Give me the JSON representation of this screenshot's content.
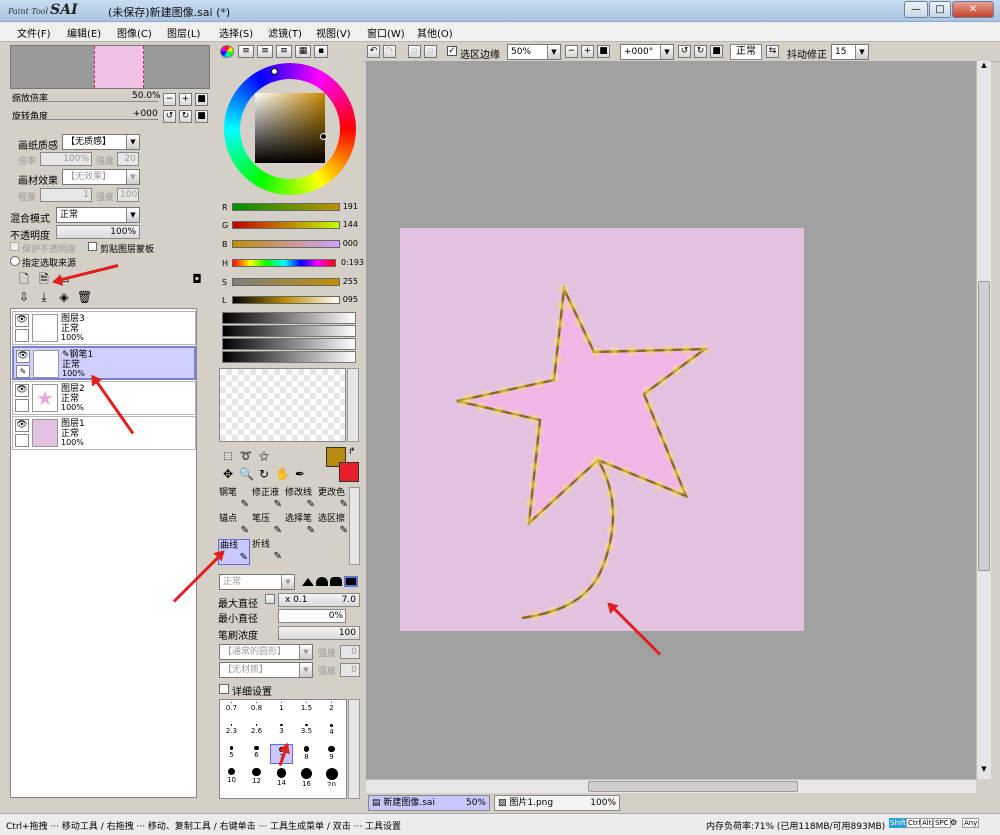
{
  "window": {
    "app_name": "PaintTool SAI",
    "app_prefix": "Paint Tool",
    "app_short": "SAI",
    "title": "(未保存)新建图像.sai (*)",
    "minimize": "—",
    "maximize": "□",
    "close": "✕"
  },
  "menu": [
    "文件(F)",
    "编辑(E)",
    "图像(C)",
    "图层(L)",
    "选择(S)",
    "滤镜(T)",
    "视图(V)",
    "窗口(W)",
    "其他(O)"
  ],
  "navigator": {
    "zoom_label": "缩放倍率",
    "zoom_value": "50.0%",
    "rotate_label": "旋转角度",
    "rotate_value": "+000"
  },
  "texture": {
    "paper_label": "画纸质感",
    "paper_value": "【无质感】",
    "scale_label": "倍率",
    "scale_value": "100%",
    "strength_label": "强度",
    "strength_value": "20",
    "effect_label": "画材效果",
    "effect_value": "【无效果】",
    "width_label": "程度",
    "width_value": "1",
    "strength2_label": "强度",
    "strength2_value": "100"
  },
  "layer_props": {
    "blend_label": "混合模式",
    "blend_value": "正常",
    "opacity_label": "不透明度",
    "opacity_value": "100%",
    "protect_label": "保护不透明度",
    "clip_label": "剪贴图层蒙板",
    "select_src_label": "指定选取来源"
  },
  "layers": [
    {
      "name": "图层3",
      "mode": "正常",
      "opacity": "100%",
      "selected": false
    },
    {
      "name": "钢笔1",
      "mode": "正常",
      "opacity": "100%",
      "selected": true
    },
    {
      "name": "图层2",
      "mode": "正常",
      "opacity": "100%",
      "selected": false
    },
    {
      "name": "图层1",
      "mode": "正常",
      "opacity": "100%",
      "selected": false
    }
  ],
  "color": {
    "r_label": "R",
    "r_value": "191",
    "r_level": 0.75,
    "g_label": "G",
    "g_value": "144",
    "g_level": 0.56,
    "b_label": "B",
    "b_value": "000",
    "b_level": 0.0,
    "h_label": "H",
    "h_value": "0:193",
    "s_label": "S",
    "s_value": "255",
    "l_label": "L",
    "l_value": "095",
    "primary": "#b58a10",
    "secondary": "#e8202c"
  },
  "tools": [
    {
      "label": "钢笔",
      "selected": false
    },
    {
      "label": "修正液",
      "selected": false
    },
    {
      "label": "修改线",
      "selected": false
    },
    {
      "label": "更改色",
      "selected": false
    },
    {
      "label": "锚点",
      "selected": false
    },
    {
      "label": "笔压",
      "selected": false
    },
    {
      "label": "选择笔",
      "selected": false
    },
    {
      "label": "选区擦",
      "selected": false
    },
    {
      "label": "曲线",
      "selected": true
    },
    {
      "label": "折线",
      "selected": false
    }
  ],
  "brush": {
    "mode_value": "正常",
    "max_label": "最大直径",
    "max_mult": "x 0.1",
    "max_value": "7.0",
    "min_label": "最小直径",
    "min_value": "0%",
    "density_label": "笔刷浓度",
    "density_value": "100",
    "shape_value": "【通常的圆形】",
    "shape_strength_label": "强度",
    "shape_strength_value": "0",
    "texture_value": "【无材质】",
    "texture_strength_label": "强度",
    "texture_strength_value": "0",
    "detail_label": "详细设置",
    "sizes": [
      "0.7",
      "0.8",
      "1",
      "1.5",
      "2",
      "2.3",
      "2.6",
      "3",
      "3.5",
      "4",
      "5",
      "6",
      "7",
      "8",
      "9",
      "10",
      "12",
      "14",
      "16",
      "20"
    ],
    "selected_size": "7"
  },
  "canvas_toolbar": {
    "sel_edge_label": "选区边缘",
    "zoom_value": "50%",
    "angle_value": "+000°",
    "mode_value": "正常",
    "stabilizer_label": "抖动修正",
    "stabilizer_value": "15"
  },
  "docs": [
    {
      "name": "新建图像.sai",
      "zoom": "50%",
      "active": true
    },
    {
      "name": "图片1.png",
      "zoom": "100%",
      "active": false
    }
  ],
  "status": {
    "hint": "Ctrl+拖拽 ··· 移动工具 / 右拖拽 ··· 移动、复制工具 / 右键单击 ··· 工具生成菜单 / 双击 ··· 工具设置",
    "memory": "内存负荷率:71% (已用118MB/可用893MB)",
    "keys": [
      "Shift",
      "Ctrl",
      "Alt",
      "SPC",
      "Any"
    ]
  },
  "colors": {
    "paper": "#e3c2df",
    "star_fill": "#f0b6e6",
    "stroke": "#8a6a10",
    "glow": "#ffe860",
    "arrow": "#e02020"
  }
}
